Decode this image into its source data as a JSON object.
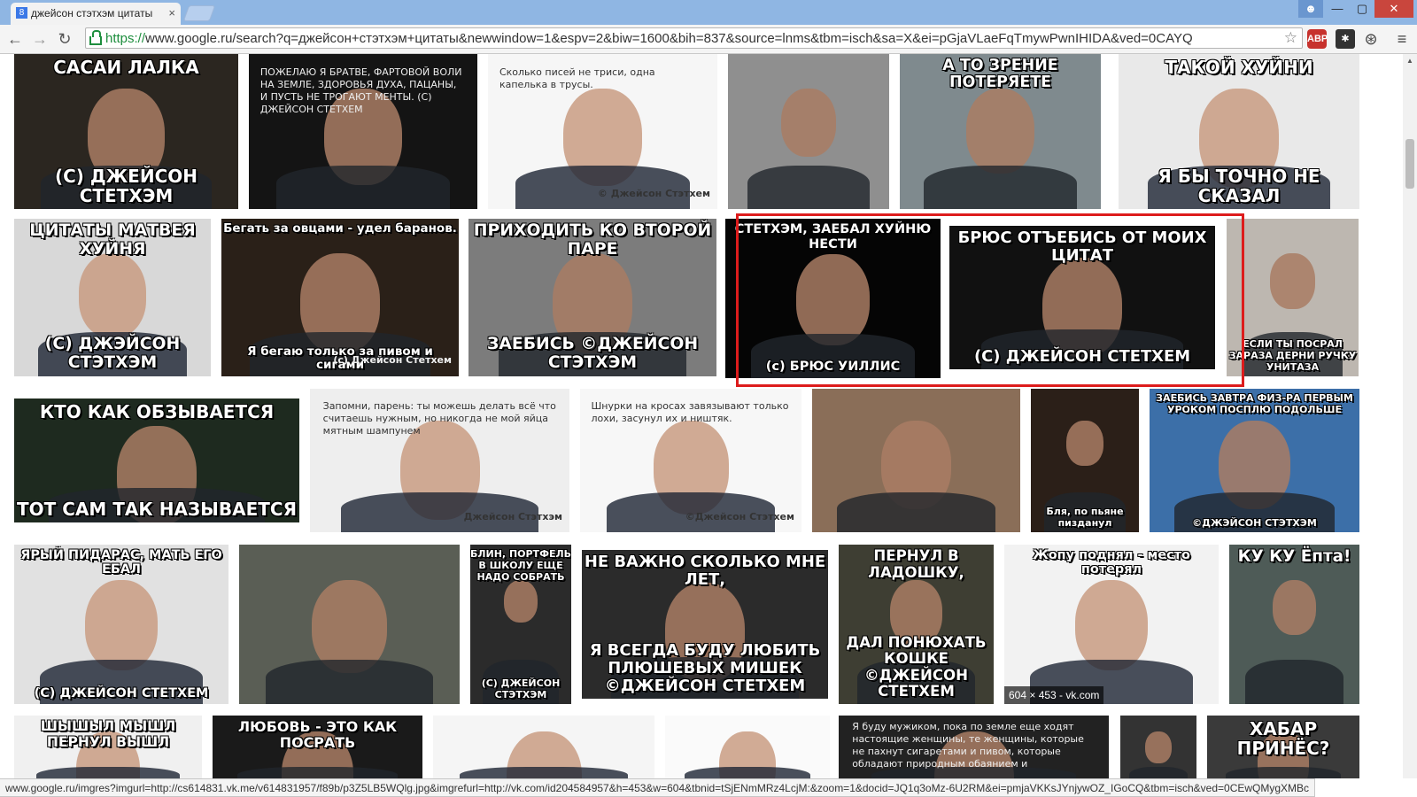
{
  "window": {
    "tab_title": "джейсон стэтхэм цитаты",
    "tab_close": "×",
    "user_icon": "user-icon",
    "min_glyph": "—",
    "max_glyph": "▢",
    "close_glyph": "✕"
  },
  "toolbar": {
    "back_glyph": "←",
    "forward_glyph": "→",
    "reload_glyph": "↻",
    "url_scheme": "https://",
    "url_rest": "www.google.ru/search?q=джейсон+стэтхэм+цитаты&newwindow=1&espv=2&biw=1600&bih=837&source=lnms&tbm=isch&sa=X&ei=pGjaVLaeFqTmywPwnIHIDA&ved=0CAYQ",
    "star_glyph": "☆",
    "abp_label": "ABP",
    "puzzle_glyph": "✱",
    "globe_glyph": "⊛",
    "menu_glyph": "≡"
  },
  "results": [
    {
      "top": "САСАИ ЛАЛКА",
      "bot": "(С) ДЖЕЙСОН СТЕТХЭМ"
    },
    {
      "note": "ПОЖЕЛАЮ Я БРАТВЕ, ФАРТОВОЙ ВОЛИ НА ЗЕМЛЕ, ЗДОРОВЬЯ ДУХА, ПАЦАНЫ, И ПУСТЬ НЕ ТРОГАЮТ МЕНТЫ. (С) ДЖЕЙСОН СТЕТХЕМ"
    },
    {
      "note": "Сколько писей не триси, одна капелька в трусы.",
      "note2": "© Джейсон Стэтхем"
    },
    {},
    {
      "top": "А ТО ЗРЕНИЕ ПОТЕРЯЕТЕ"
    },
    {
      "top": "ТАКОЙ ХУЙНИ",
      "bot": "Я БЫ ТОЧНО НЕ СКАЗАЛ"
    },
    {
      "top": "ЦИТАТЫ МАТВЕЯ ХУЙНЯ",
      "bot": "(С) ДЖЭЙСОН СТЭТХЭМ"
    },
    {
      "top": "Бегать за овцами - удел баранов.",
      "bot": "Я бегаю только за пивом и сигами",
      "note2": "(с) Джейсон Стетхем"
    },
    {
      "top": "ПРИХОДИТЬ КО ВТОРОЙ ПАРЕ",
      "bot": "ЗАЕБИСЬ ©ДЖЕЙСОН СТЭТХЭМ"
    },
    {
      "top": "СТЕТХЭМ, ЗАЕБАЛ ХУЙНЮ НЕСТИ",
      "bot": "(с) БРЮС УИЛЛИС"
    },
    {
      "top": "БРЮС ОТЪЕБИСЬ ОТ МОИХ ЦИТАТ",
      "bot": "(С) ДЖЕЙСОН СТЕТХЕМ"
    },
    {
      "bot": "ЕСЛИ ТЫ ПОСРАЛ ЗАРАЗА ДЕРНИ РУЧКУ УНИТАЗА"
    },
    {
      "top": "КТО КАК ОБЗЫВАЕТСЯ",
      "bot": "ТОТ САМ ТАК НАЗЫВАЕТСЯ"
    },
    {
      "note": "Запомни, парень: ты можешь делать всё что считаешь нужным, но никогда не мой яйца мятным шампунем",
      "note2": "Джейсон Стэтхэм"
    },
    {
      "note": "Шнурки на кросах завязывают только лохи, засунул их и ништяк.",
      "note2": "©Джейсон Стэтхем"
    },
    {},
    {
      "bot": "Бля, по пьяне пизданул"
    },
    {
      "top": "ЗАЕБИСЬ ЗАВТРА ФИЗ-РА ПЕРВЫМ УРОКОМ ПОСПЛЮ ПОДОЛЬШЕ",
      "bot": "©ДЖЭЙСОН СТЭТХЭМ"
    },
    {
      "top": "ЯРЫЙ ПИДАРАС, МАТЬ ЕГО ЕБАЛ",
      "bot": "(С) ДЖЕЙСОН СТЕТХЕМ"
    },
    {},
    {
      "top": "БЛИН, ПОРТФЕЛЬ В ШКОЛУ ЕЩЕ НАДО СОБРАТЬ",
      "bot": "(С) ДЖЕЙСОН СТЭТХЭМ"
    },
    {
      "top": "НЕ ВАЖНО СКОЛЬКО МНЕ ЛЕТ,",
      "bot": "Я ВСЕГДА БУДУ ЛЮБИТЬ ПЛЮШЕВЫХ МИШЕК ©ДЖЕЙСОН СТЕТХЕМ"
    },
    {
      "top": "ПЕРНУЛ В ЛАДОШКУ,",
      "bot": "ДАЛ ПОНЮХАТЬ КОШКЕ ©ДЖЕЙСОН СТЕТХЕМ"
    },
    {
      "top": "Жопу поднял - место потерял",
      "meta": "604 × 453 - vk.com"
    },
    {
      "top": "КУ КУ Ёпта!"
    },
    {
      "top": "ШЫШЫЛ МЫШЛ ПЕРНУЛ ВЫШЛ"
    },
    {
      "top": "ЛЮБОВЬ - ЭТО КАК ПОСРАТЬ"
    },
    {},
    {},
    {
      "note": "Я буду мужиком, пока по земле еще ходят настоящие женщины, те женщины, которые не пахнут сигаретами и пивом, которые обладают природным обаянием и"
    },
    {},
    {
      "top": "ХАБАР ПРИНЁС?"
    }
  ],
  "status_url": "www.google.ru/imgres?imgurl=http://cs614831.vk.me/v614831957/f89b/p3Z5LB5WQlg.jpg&imgrefurl=http://vk.com/id204584957&h=453&w=604&tbnid=tSjENmMRz4LcjM:&zoom=1&docid=JQ1q3oMz-6U2RM&ei=pmjaVKKsJYnjywOZ_IGoCQ&tbm=isch&ved=0CEwQMygXMBc"
}
